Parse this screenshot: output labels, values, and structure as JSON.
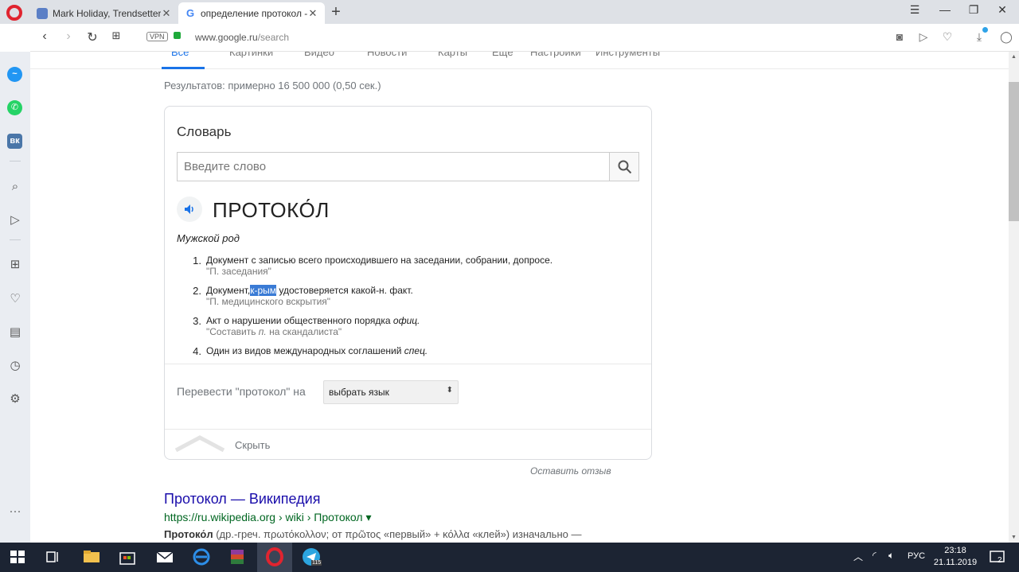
{
  "browser": {
    "tabs": [
      {
        "title": "Mark Holiday, Trendsetter,"
      },
      {
        "title": "определение протокол - I"
      }
    ],
    "address": {
      "host": "www.google.ru",
      "path": "/search"
    },
    "vpn_label": "VPN"
  },
  "google_nav": {
    "items": [
      "Все",
      "Картинки",
      "Видео",
      "Новости",
      "Карты",
      "Ещё",
      "Настройки",
      "Инструменты"
    ]
  },
  "results_stats": "Результатов: примерно 16 500 000 (0,50 сек.)",
  "dictionary": {
    "title": "Словарь",
    "search_placeholder": "Введите слово",
    "headword": "ПРОТОКО́Л",
    "part_of_speech": "Мужской род",
    "definitions": [
      {
        "num": "1.",
        "text": "Документ с записью всего происходившего на заседании, собрании, допросе.",
        "example": "\"П. заседания\""
      },
      {
        "num": "2.",
        "text_before": "Документ,",
        "highlight": "к-рым",
        "text_after": " удостоверяется какой-н. факт.",
        "example": "\"П. медицинского вскрытия\""
      },
      {
        "num": "3.",
        "text": "Акт о нарушении общественного порядка ",
        "text_italic": "офиц.",
        "example_before": "\"Составить ",
        "example_italic": "п.",
        "example_after": " на скандалиста\""
      },
      {
        "num": "4.",
        "text": "Один из видов международных соглашений ",
        "text_italic": "спец."
      }
    ],
    "translate_label": "Перевести \"протокол\" на",
    "language_select": "выбрать язык",
    "collapse_label": "Скрыть"
  },
  "feedback_link": "Оставить отзыв",
  "result": {
    "title": "Протокол — Википедия",
    "url": "https://ru.wikipedia.org › wiki › Протокол ▾",
    "snippet_bold": "Протоко́л",
    "snippet_rest": " (др.-греч. πρωτόκολλον; от πρῶτος «первый» + κόλλα «клей») изначально —"
  },
  "taskbar": {
    "lang": "РУС",
    "time": "23:18",
    "date": "21.11.2019",
    "notification_count": "2",
    "telegram_badge": "115"
  },
  "colors": {
    "link": "#1a0dab",
    "url_green": "#006621",
    "accent": "#1a73e8",
    "highlight": "#3a7bd5",
    "opera_red": "#e0242f"
  }
}
